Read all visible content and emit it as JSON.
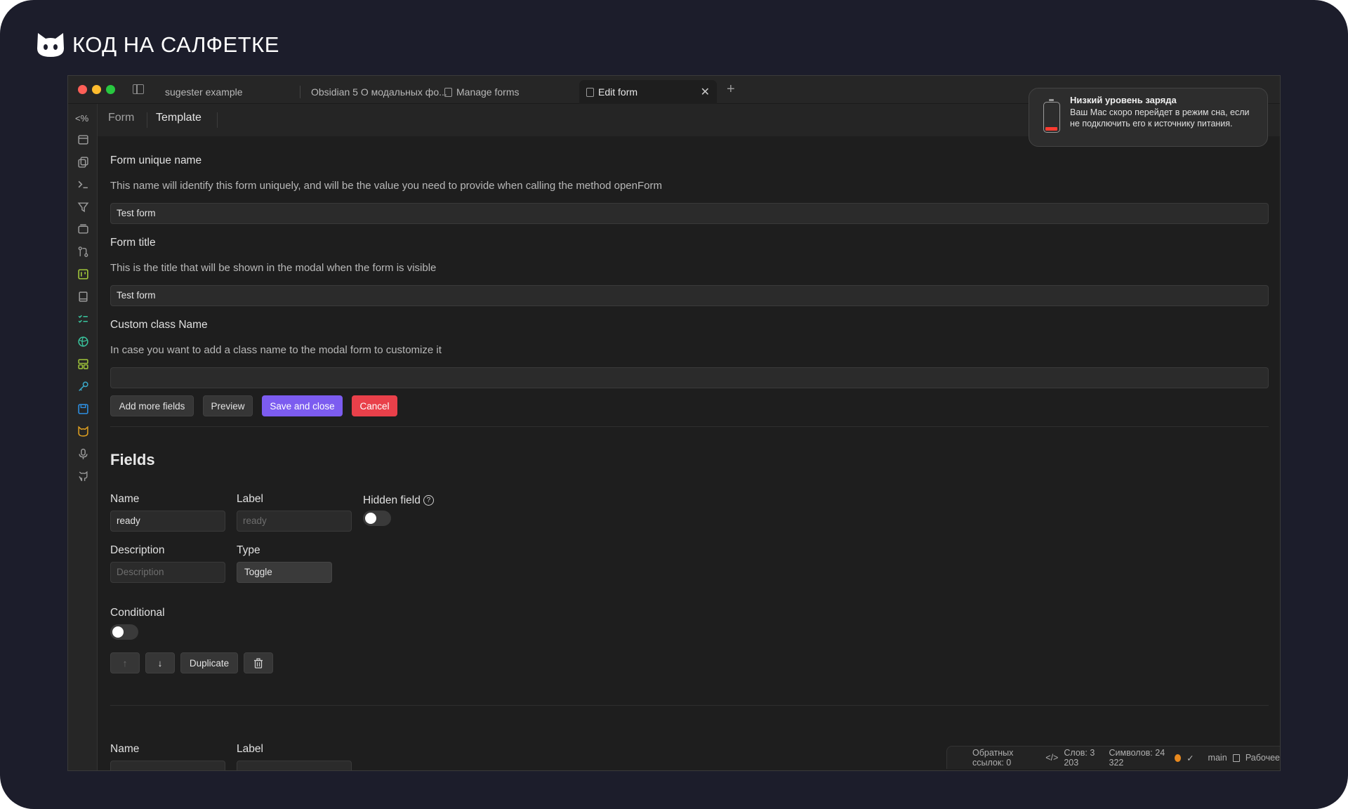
{
  "brand": {
    "text": "КОД НА САЛФЕТКЕ",
    "logo_icon": "cat-icon"
  },
  "tabs": [
    {
      "label": "sugester example"
    },
    {
      "label": "Obsidian 5 О модальных фо..."
    },
    {
      "label": "Manage forms"
    },
    {
      "label": "Edit form"
    }
  ],
  "view_tabs": {
    "form": "Form",
    "template": "Template"
  },
  "form": {
    "unique_name_label": "Form unique name",
    "unique_name_desc": "This name will identify this form uniquely, and will be the value you need to provide when calling the method openForm",
    "unique_name_value": "Test form",
    "title_label": "Form title",
    "title_desc": "This is the title that will be shown in the modal when the form is visible",
    "title_value": "Test form",
    "class_label": "Custom class Name",
    "class_desc": "In case you want to add a class name to the modal form to customize it",
    "class_value": ""
  },
  "actions": {
    "add_more_fields": "Add more fields",
    "preview": "Preview",
    "save_and_close": "Save and close",
    "cancel": "Cancel"
  },
  "fields": {
    "heading": "Fields",
    "name_label": "Name",
    "name_value": "ready",
    "label_label": "Label",
    "label_placeholder": "ready",
    "hidden_label": "Hidden field",
    "hidden_on": false,
    "description_label": "Description",
    "description_placeholder": "Description",
    "type_label": "Type",
    "type_value": "Toggle",
    "conditional_label": "Conditional",
    "conditional_on": false,
    "duplicate": "Duplicate",
    "second_name_label": "Name",
    "second_label_label": "Label"
  },
  "notification": {
    "title": "Низкий уровень заряда",
    "body": "Ваш Mac скоро перейдет в режим сна, если не подключить его к источнику питания."
  },
  "status": {
    "backlinks": "Обратных ссылок: 0",
    "words": "Слов: 3 203",
    "chars": "Символов: 24 322",
    "branch": "main",
    "workspace": "Рабочее"
  },
  "colors": {
    "accent": "#7c5cf0",
    "danger": "#e9404a",
    "status_dot": "#e8891e"
  }
}
